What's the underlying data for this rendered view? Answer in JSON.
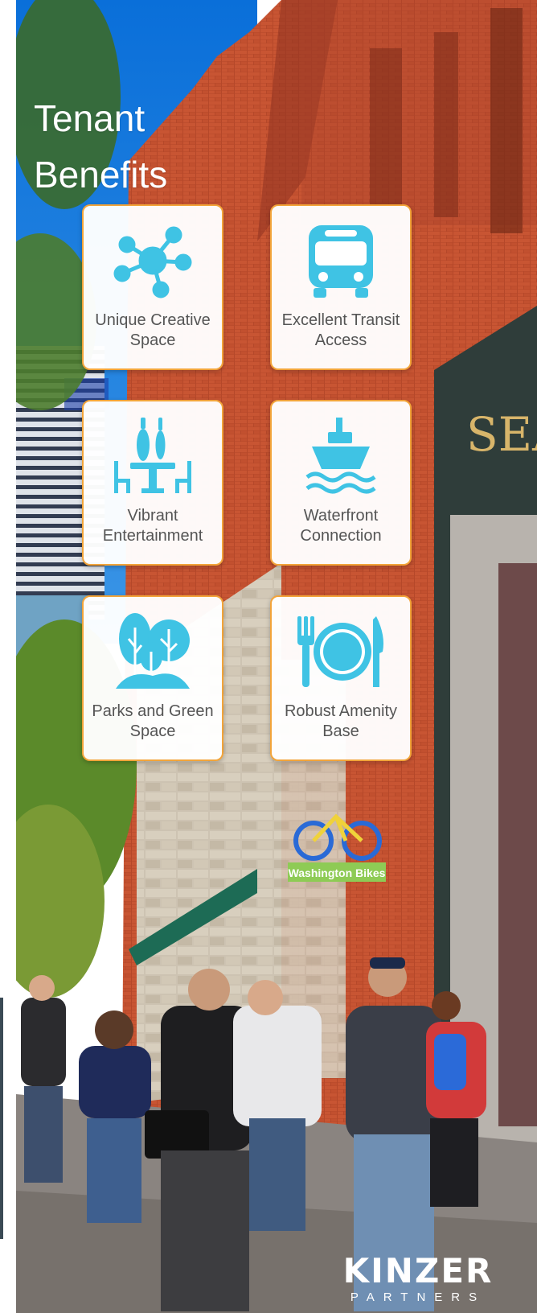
{
  "title": {
    "line1": "Tenant",
    "line2": "Benefits"
  },
  "colors": {
    "icon": "#3fc3e4",
    "card_border": "#f2a43a",
    "label": "#555555"
  },
  "cards": [
    {
      "label": "Unique Creative Space",
      "icon": "network-hub-icon"
    },
    {
      "label": "Excellent Transit Access",
      "icon": "bus-icon"
    },
    {
      "label": "Vibrant Entertainment",
      "icon": "table-bottles-chairs-icon"
    },
    {
      "label": "Waterfront Connection",
      "icon": "ferry-boat-icon"
    },
    {
      "label": "Parks and Green Space",
      "icon": "trees-icon"
    },
    {
      "label": "Robust Amenity Base",
      "icon": "fork-plate-knife-icon"
    }
  ],
  "logo": {
    "brand": "KINZER",
    "sub": "PARTNERS"
  },
  "background": {
    "shop_sign": "Washington Bikes",
    "building_letters": "SEA"
  }
}
